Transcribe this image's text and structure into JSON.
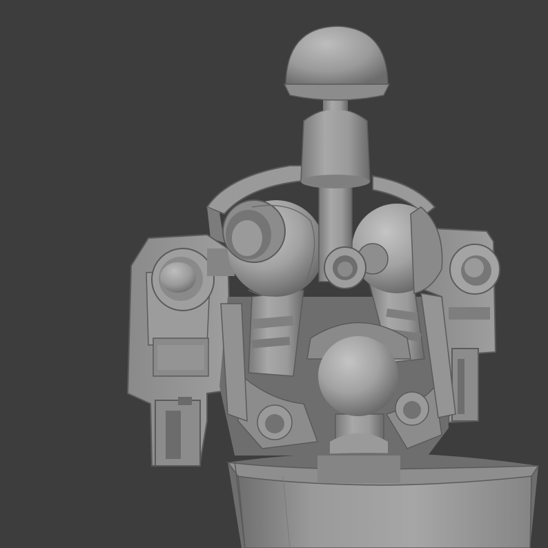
{
  "viewport": {
    "background": "#3d3d3d",
    "subject": "robot-torso-mechanism-render",
    "palette": {
      "base": "#8e8e8e",
      "light": "#b4b4b4",
      "mid": "#9c9c9c",
      "shadow": "#626262",
      "deep": "#4a4a4a"
    }
  }
}
